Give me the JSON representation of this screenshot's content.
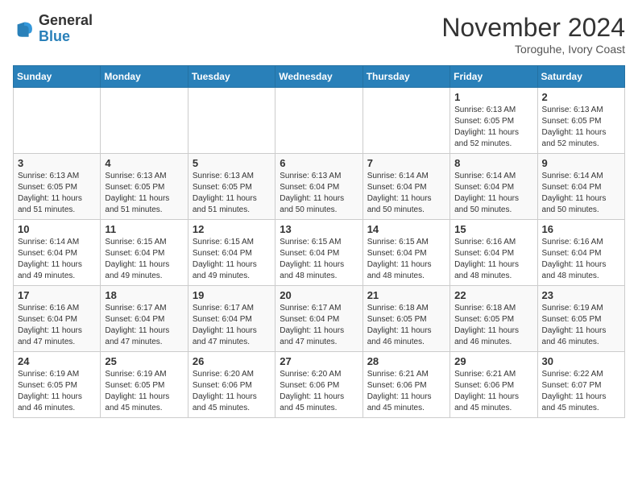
{
  "logo": {
    "general": "General",
    "blue": "Blue"
  },
  "header": {
    "month": "November 2024",
    "location": "Toroguhe, Ivory Coast"
  },
  "weekdays": [
    "Sunday",
    "Monday",
    "Tuesday",
    "Wednesday",
    "Thursday",
    "Friday",
    "Saturday"
  ],
  "weeks": [
    [
      {
        "day": "",
        "info": ""
      },
      {
        "day": "",
        "info": ""
      },
      {
        "day": "",
        "info": ""
      },
      {
        "day": "",
        "info": ""
      },
      {
        "day": "",
        "info": ""
      },
      {
        "day": "1",
        "info": "Sunrise: 6:13 AM\nSunset: 6:05 PM\nDaylight: 11 hours and 52 minutes."
      },
      {
        "day": "2",
        "info": "Sunrise: 6:13 AM\nSunset: 6:05 PM\nDaylight: 11 hours and 52 minutes."
      }
    ],
    [
      {
        "day": "3",
        "info": "Sunrise: 6:13 AM\nSunset: 6:05 PM\nDaylight: 11 hours and 51 minutes."
      },
      {
        "day": "4",
        "info": "Sunrise: 6:13 AM\nSunset: 6:05 PM\nDaylight: 11 hours and 51 minutes."
      },
      {
        "day": "5",
        "info": "Sunrise: 6:13 AM\nSunset: 6:05 PM\nDaylight: 11 hours and 51 minutes."
      },
      {
        "day": "6",
        "info": "Sunrise: 6:13 AM\nSunset: 6:04 PM\nDaylight: 11 hours and 50 minutes."
      },
      {
        "day": "7",
        "info": "Sunrise: 6:14 AM\nSunset: 6:04 PM\nDaylight: 11 hours and 50 minutes."
      },
      {
        "day": "8",
        "info": "Sunrise: 6:14 AM\nSunset: 6:04 PM\nDaylight: 11 hours and 50 minutes."
      },
      {
        "day": "9",
        "info": "Sunrise: 6:14 AM\nSunset: 6:04 PM\nDaylight: 11 hours and 50 minutes."
      }
    ],
    [
      {
        "day": "10",
        "info": "Sunrise: 6:14 AM\nSunset: 6:04 PM\nDaylight: 11 hours and 49 minutes."
      },
      {
        "day": "11",
        "info": "Sunrise: 6:15 AM\nSunset: 6:04 PM\nDaylight: 11 hours and 49 minutes."
      },
      {
        "day": "12",
        "info": "Sunrise: 6:15 AM\nSunset: 6:04 PM\nDaylight: 11 hours and 49 minutes."
      },
      {
        "day": "13",
        "info": "Sunrise: 6:15 AM\nSunset: 6:04 PM\nDaylight: 11 hours and 48 minutes."
      },
      {
        "day": "14",
        "info": "Sunrise: 6:15 AM\nSunset: 6:04 PM\nDaylight: 11 hours and 48 minutes."
      },
      {
        "day": "15",
        "info": "Sunrise: 6:16 AM\nSunset: 6:04 PM\nDaylight: 11 hours and 48 minutes."
      },
      {
        "day": "16",
        "info": "Sunrise: 6:16 AM\nSunset: 6:04 PM\nDaylight: 11 hours and 48 minutes."
      }
    ],
    [
      {
        "day": "17",
        "info": "Sunrise: 6:16 AM\nSunset: 6:04 PM\nDaylight: 11 hours and 47 minutes."
      },
      {
        "day": "18",
        "info": "Sunrise: 6:17 AM\nSunset: 6:04 PM\nDaylight: 11 hours and 47 minutes."
      },
      {
        "day": "19",
        "info": "Sunrise: 6:17 AM\nSunset: 6:04 PM\nDaylight: 11 hours and 47 minutes."
      },
      {
        "day": "20",
        "info": "Sunrise: 6:17 AM\nSunset: 6:04 PM\nDaylight: 11 hours and 47 minutes."
      },
      {
        "day": "21",
        "info": "Sunrise: 6:18 AM\nSunset: 6:05 PM\nDaylight: 11 hours and 46 minutes."
      },
      {
        "day": "22",
        "info": "Sunrise: 6:18 AM\nSunset: 6:05 PM\nDaylight: 11 hours and 46 minutes."
      },
      {
        "day": "23",
        "info": "Sunrise: 6:19 AM\nSunset: 6:05 PM\nDaylight: 11 hours and 46 minutes."
      }
    ],
    [
      {
        "day": "24",
        "info": "Sunrise: 6:19 AM\nSunset: 6:05 PM\nDaylight: 11 hours and 46 minutes."
      },
      {
        "day": "25",
        "info": "Sunrise: 6:19 AM\nSunset: 6:05 PM\nDaylight: 11 hours and 45 minutes."
      },
      {
        "day": "26",
        "info": "Sunrise: 6:20 AM\nSunset: 6:06 PM\nDaylight: 11 hours and 45 minutes."
      },
      {
        "day": "27",
        "info": "Sunrise: 6:20 AM\nSunset: 6:06 PM\nDaylight: 11 hours and 45 minutes."
      },
      {
        "day": "28",
        "info": "Sunrise: 6:21 AM\nSunset: 6:06 PM\nDaylight: 11 hours and 45 minutes."
      },
      {
        "day": "29",
        "info": "Sunrise: 6:21 AM\nSunset: 6:06 PM\nDaylight: 11 hours and 45 minutes."
      },
      {
        "day": "30",
        "info": "Sunrise: 6:22 AM\nSunset: 6:07 PM\nDaylight: 11 hours and 45 minutes."
      }
    ]
  ]
}
